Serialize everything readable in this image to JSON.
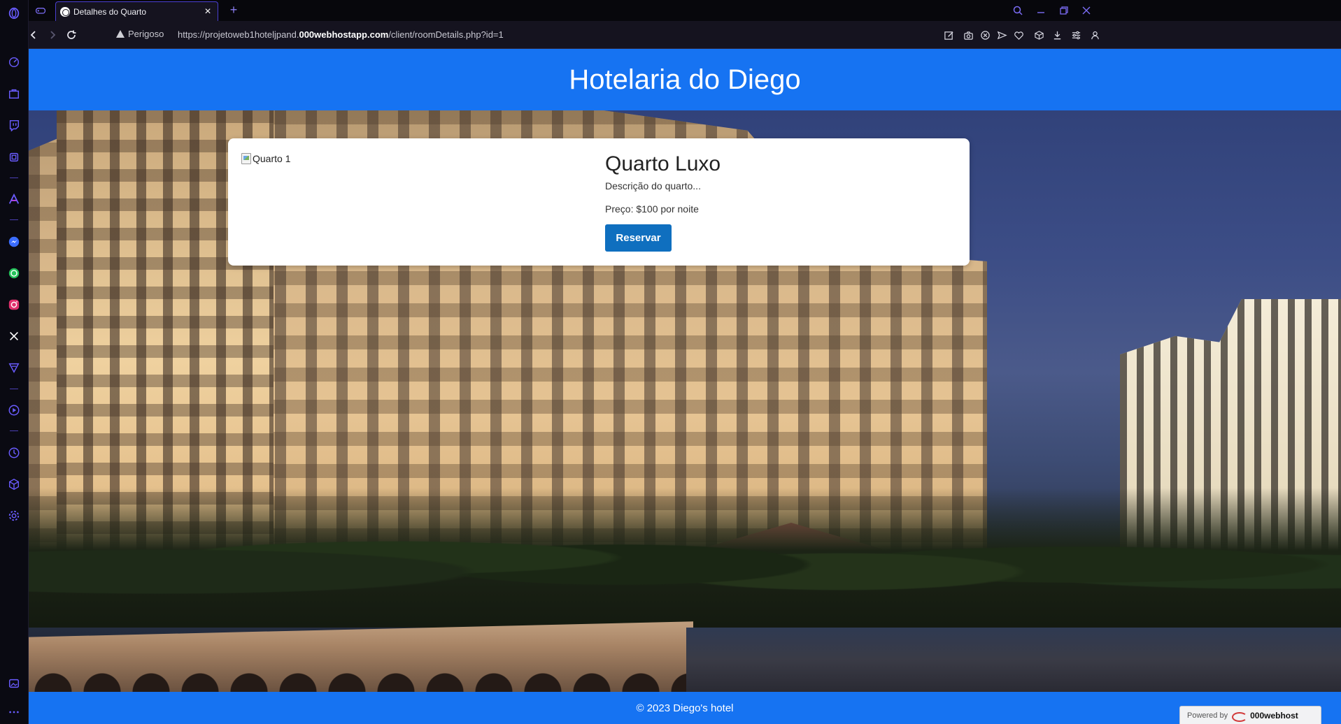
{
  "browser": {
    "tab_title": "Detalhes do Quarto",
    "tab_close": "×",
    "new_tab": "+",
    "security_label": "Perigoso",
    "url_prefix": "https://projetoweb1hoteljpand.",
    "url_domain": "000webhostapp.com",
    "url_suffix": "/client/roomDetails.php?id=1"
  },
  "site": {
    "header_title": "Hotelaria do Diego",
    "footer_text": "© 2023 Diego's hotel"
  },
  "room": {
    "image_alt": "Quarto 1",
    "title": "Quarto Luxo",
    "description": "Descrição do quarto...",
    "price": "Preço: $100 por noite",
    "reserve_label": "Reservar"
  },
  "badge": {
    "powered_by": "Powered by",
    "brand": "000webhost"
  },
  "colors": {
    "header_blue": "#1673f2",
    "button_blue": "#0f6fbf",
    "browser_accent": "#4a3fd2"
  },
  "icons": {
    "sidebar": [
      "opera-logo-icon",
      "speed-dial-icon",
      "shopping-bag-icon",
      "twitch-icon",
      "extension-icon",
      "aria-icon",
      "messenger-icon",
      "whatsapp-icon",
      "instagram-icon",
      "x-icon",
      "vpn-icon",
      "player-icon",
      "history-icon",
      "cube-icon",
      "settings-icon",
      "gallery-icon",
      "more-icon"
    ],
    "toolbar": [
      "edit-icon",
      "camera-icon",
      "close-circle-icon",
      "send-icon",
      "heart-icon",
      "box-icon",
      "download-icon",
      "easy-setup-icon",
      "account-icon"
    ]
  }
}
